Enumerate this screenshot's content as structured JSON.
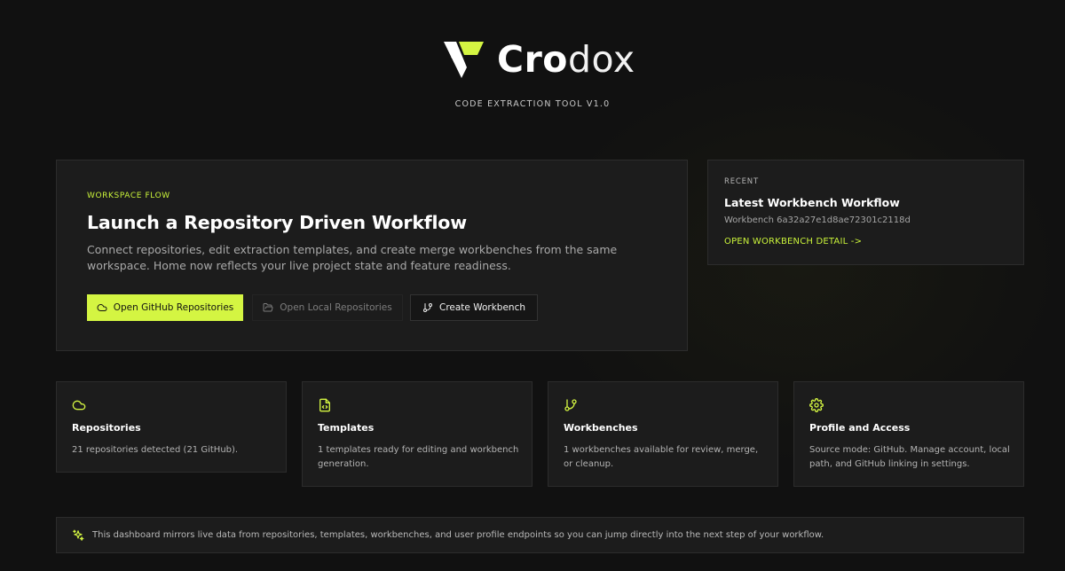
{
  "brand": {
    "name_bold": "Cro",
    "name_light": "dox",
    "tagline": "CODE EXTRACTION TOOL V1.0",
    "accent_color": "#d4f542"
  },
  "hero": {
    "eyebrow": "WORKSPACE FLOW",
    "title": "Launch a Repository Driven Workflow",
    "description": "Connect repositories, edit extraction templates, and create merge workbenches from the same workspace. Home now reflects your live project state and feature readiness.",
    "buttons": {
      "github": "Open GitHub Repositories",
      "local": "Open Local Repositories",
      "workbench": "Create Workbench"
    }
  },
  "recent": {
    "eyebrow": "RECENT",
    "title": "Latest Workbench Workflow",
    "workbench_id": "Workbench 6a32a27e1d8ae72301c2118d",
    "link": "OPEN WORKBENCH DETAIL ->"
  },
  "features": [
    {
      "icon": "cloud-icon",
      "title": "Repositories",
      "description": "21 repositories detected (21 GitHub)."
    },
    {
      "icon": "file-code-icon",
      "title": "Templates",
      "description": "1 templates ready for editing and workbench generation."
    },
    {
      "icon": "git-branch-icon",
      "title": "Workbenches",
      "description": "1 workbenches available for review, merge, or cleanup."
    },
    {
      "icon": "gear-icon",
      "title": "Profile and Access",
      "description": "Source mode: GitHub. Manage account, local path, and GitHub linking in settings."
    }
  ],
  "footer": {
    "icon": "sparkles-icon",
    "text": "This dashboard mirrors live data from repositories, templates, workbenches, and user profile endpoints so you can jump directly into the next step of your workflow."
  }
}
